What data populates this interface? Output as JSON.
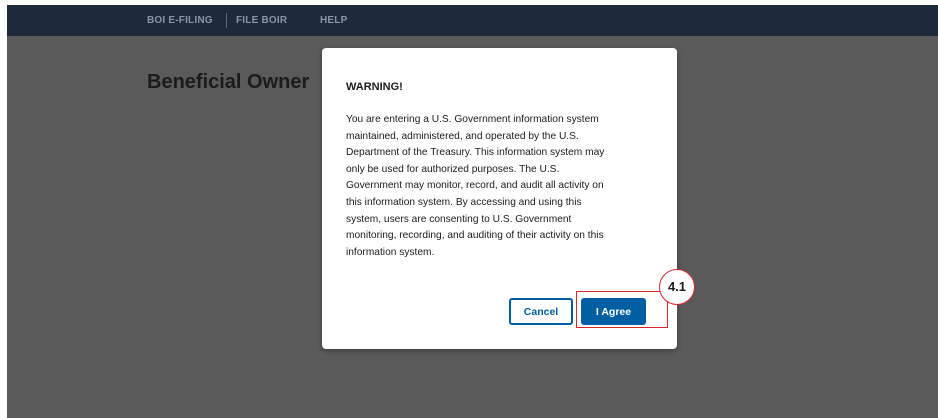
{
  "nav": {
    "items": [
      {
        "label": "BOI E-FILING"
      },
      {
        "label": "FILE BOIR"
      },
      {
        "label": "HELP"
      }
    ]
  },
  "page": {
    "title": "Beneficial Owner"
  },
  "modal": {
    "title": "WARNING!",
    "body_lines": [
      "You are entering a U.S. Government information system",
      "maintained, administered, and operated by the U.S.",
      "Department of the Treasury. This information system may",
      "only be used for authorized purposes. The U.S.",
      "Government may monitor, record, and audit all activity on",
      "this information system. By accessing and using this",
      "system, users are consenting to U.S. Government",
      "monitoring, recording, and auditing of their activity on this",
      "information system."
    ],
    "cancel_label": "Cancel",
    "agree_label": "I Agree"
  },
  "annotation": {
    "step_label": "4.1"
  },
  "colors": {
    "nav_background": "#1c2a3a",
    "overlay": "#5a5a5a",
    "primary": "#005ea2",
    "annotation": "#d9262c"
  }
}
